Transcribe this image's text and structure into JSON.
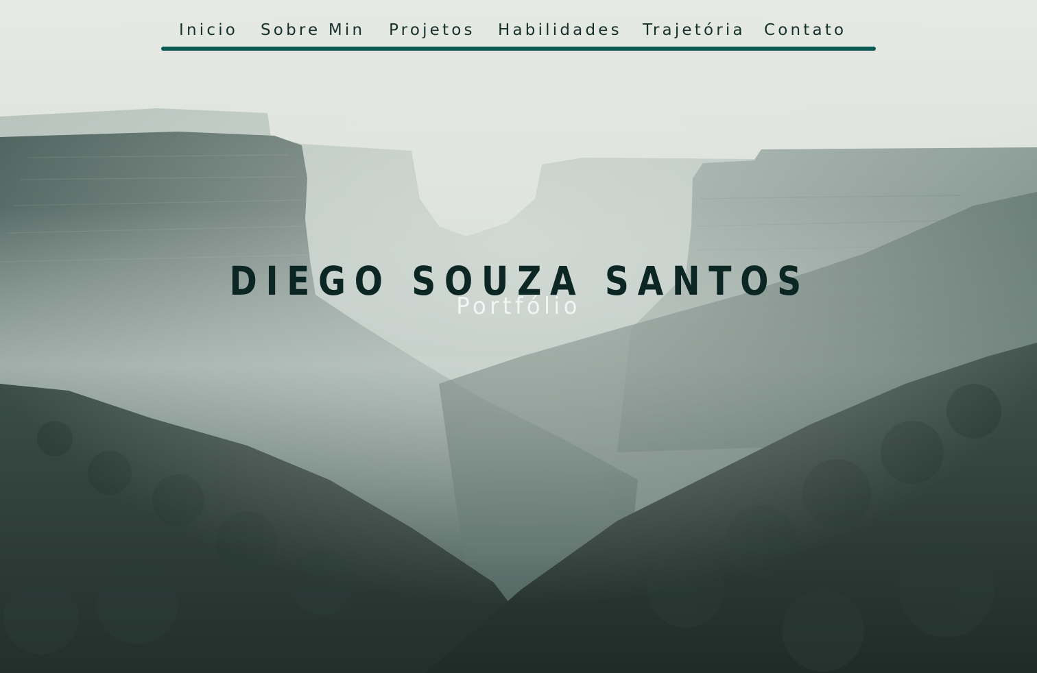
{
  "nav": {
    "items": [
      {
        "label": "Inicio"
      },
      {
        "label": "Sobre Min"
      },
      {
        "label": "Projetos"
      },
      {
        "label": "Habilidades"
      },
      {
        "label": "Trajetória"
      },
      {
        "label": "Contato"
      }
    ]
  },
  "hero": {
    "title": "DIEGO SOUZA SANTOS",
    "subtitle": "Portfólio",
    "background": "misty-canyon-landscape"
  },
  "colors": {
    "accent": "#0e5a55",
    "title": "#0c2624",
    "subtitle": "#f2f5f3",
    "nav_text": "#17302d"
  }
}
